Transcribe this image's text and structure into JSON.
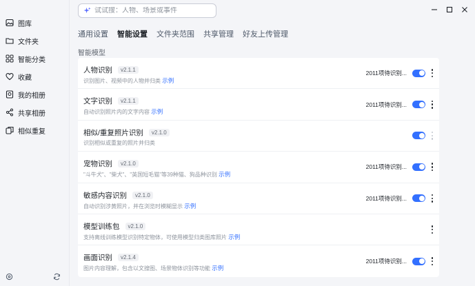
{
  "sidebar": {
    "items": [
      {
        "label": "图库",
        "icon": "gallery-icon"
      },
      {
        "label": "文件夹",
        "icon": "folder-icon"
      },
      {
        "label": "智能分类",
        "icon": "grid-icon"
      },
      {
        "label": "收藏",
        "icon": "heart-icon"
      },
      {
        "label": "我的相册",
        "icon": "album-icon"
      },
      {
        "label": "共享相册",
        "icon": "share-icon"
      },
      {
        "label": "相似重复",
        "icon": "duplicate-icon"
      }
    ]
  },
  "search": {
    "placeholder": "试试搜：人物、场景或事件"
  },
  "tabs": [
    "通用设置",
    "智能设置",
    "文件夹范围",
    "共享管理",
    "好友上传管理"
  ],
  "active_tab": "智能设置",
  "section_label": "智能模型",
  "models": [
    {
      "title": "人物识别",
      "version": "v2.1.1",
      "desc": "识别图片、视频中的人物并归类",
      "link": "示例",
      "status": "2011项待识别...",
      "enabled": true
    },
    {
      "title": "文字识别",
      "version": "v2.1.1",
      "desc": "自动识别照片内的文字内容",
      "link": "示例",
      "status": "2011项待识别...",
      "enabled": true
    },
    {
      "title": "相似/重复照片识别",
      "version": "v2.1.0",
      "desc": "识别相似或重复的照片并归类",
      "link": "",
      "status": "",
      "enabled": true
    },
    {
      "title": "宠物识别",
      "version": "v2.1.0",
      "desc": "\"斗牛犬\"、\"柴犬\"、\"英国短毛猫\"等39种猫、狗品种识别",
      "link": "示例",
      "status": "2011项待识别...",
      "enabled": true
    },
    {
      "title": "敏感内容识别",
      "version": "v2.1.0",
      "desc": "自动识别涉黄照片，并在浏览时模糊显示",
      "link": "示例",
      "status": "2011项待识别...",
      "enabled": true
    },
    {
      "title": "模型训练包",
      "version": "v2.1.0",
      "desc": "支持离线训练模型识别特定物体，可使用模型归类图库照片",
      "link": "示例",
      "status": "",
      "enabled": false
    },
    {
      "title": "画面识别",
      "version": "v2.1.4",
      "desc": "图片内容理解，包含以文搜图、场景物体识别等功能",
      "link": "示例",
      "status": "2011项待识别...",
      "enabled": true
    }
  ]
}
